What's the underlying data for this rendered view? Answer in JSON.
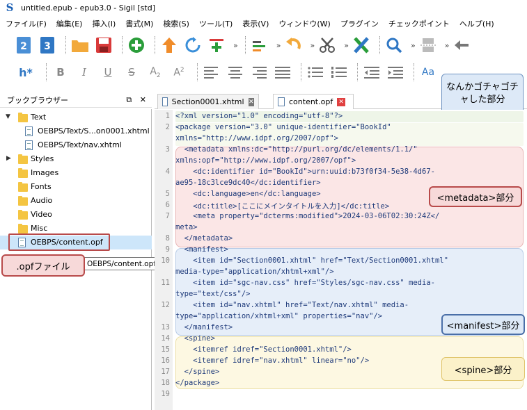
{
  "window": {
    "title": "untitled.epub - epub3.0 - Sigil [std]"
  },
  "menu": [
    "ファイル(F)",
    "編集(E)",
    "挿入(I)",
    "書式(M)",
    "検索(S)",
    "ツール(T)",
    "表示(V)",
    "ウィンドウ(W)",
    "プラグイン",
    "チェックポイント",
    "ヘルプ(H)"
  ],
  "toolbar2": {
    "heading_label": "h*",
    "case_label": "Aa"
  },
  "book_browser": {
    "title": "ブックブラウザー",
    "items": [
      {
        "label": "Text",
        "type": "folder",
        "expanded": true
      },
      {
        "label": "OEBPS/Text/S...on0001.xhtml",
        "type": "file"
      },
      {
        "label": "OEBPS/Text/nav.xhtml",
        "type": "file"
      },
      {
        "label": "Styles",
        "type": "folder",
        "expanded": false
      },
      {
        "label": "Images",
        "type": "folder"
      },
      {
        "label": "Fonts",
        "type": "folder"
      },
      {
        "label": "Audio",
        "type": "folder"
      },
      {
        "label": "Video",
        "type": "folder"
      },
      {
        "label": "Misc",
        "type": "folder"
      },
      {
        "label": "OEBPS/content.opf",
        "type": "file",
        "selected": true
      }
    ],
    "tooltip": "OEBPS/content.opf"
  },
  "tabs": [
    {
      "label": "Section0001.xhtml",
      "active": false
    },
    {
      "label": "content.opf",
      "active": true
    }
  ],
  "code_lines": [
    "<?xml version=\"1.0\" encoding=\"utf-8\"?>",
    "<package version=\"3.0\" unique-identifier=\"BookId\"",
    "xmlns=\"http://www.idpf.org/2007/opf\">",
    "  <metadata xmlns:dc=\"http://purl.org/dc/elements/1.1/\"",
    "xmlns:opf=\"http://www.idpf.org/2007/opf\">",
    "    <dc:identifier id=\"BookId\">urn:uuid:b73f0f34-5e38-4d67-",
    "ae95-18c3lce9dc40</dc:identifier>",
    "    <dc:language>en</dc:language>",
    "    <dc:title>[ここにメインタイトルを入力]</dc:title>",
    "    <meta property=\"dcterms:modified\">2024-03-06T02:30:24Z</",
    "meta>",
    "  </metadata>",
    "  <manifest>",
    "    <item id=\"Section0001.xhtml\" href=\"Text/Section0001.xhtml\"",
    "media-type=\"application/xhtml+xml\"/>",
    "    <item id=\"sgc-nav.css\" href=\"Styles/sgc-nav.css\" media-",
    "type=\"text/css\"/>",
    "    <item id=\"nav.xhtml\" href=\"Text/nav.xhtml\" media-",
    "type=\"application/xhtml+xml\" properties=\"nav\"/>",
    "  </manifest>",
    "  <spine>",
    "    <itemref idref=\"Section0001.xhtml\"/>",
    "    <itemref idref=\"nav.xhtml\" linear=\"no\"/>",
    "  </spine>",
    "</package>",
    ""
  ],
  "line_numbers": [
    "1",
    "2",
    "",
    "3",
    "",
    "4",
    "",
    "5",
    "6",
    "7",
    "",
    "8",
    "9",
    "10",
    "",
    "11",
    "",
    "12",
    "",
    "13",
    "14",
    "15",
    "16",
    "17",
    "18",
    "19"
  ],
  "callouts": {
    "toolbar": "なんかゴチャゴチャした部分",
    "opf_file": ".opfファイル",
    "metadata": "<metadata>部分",
    "manifest": "<manifest>部分",
    "spine": "<spine>部分"
  },
  "colors": {
    "xml_decl_bg": "#eef5e8",
    "package_bg": "#f6f9ee",
    "metadata_bg": "#fbe6e6",
    "manifest_bg": "#e6eef9",
    "spine_bg": "#fdf8e2",
    "selection": "#cde6fa"
  }
}
